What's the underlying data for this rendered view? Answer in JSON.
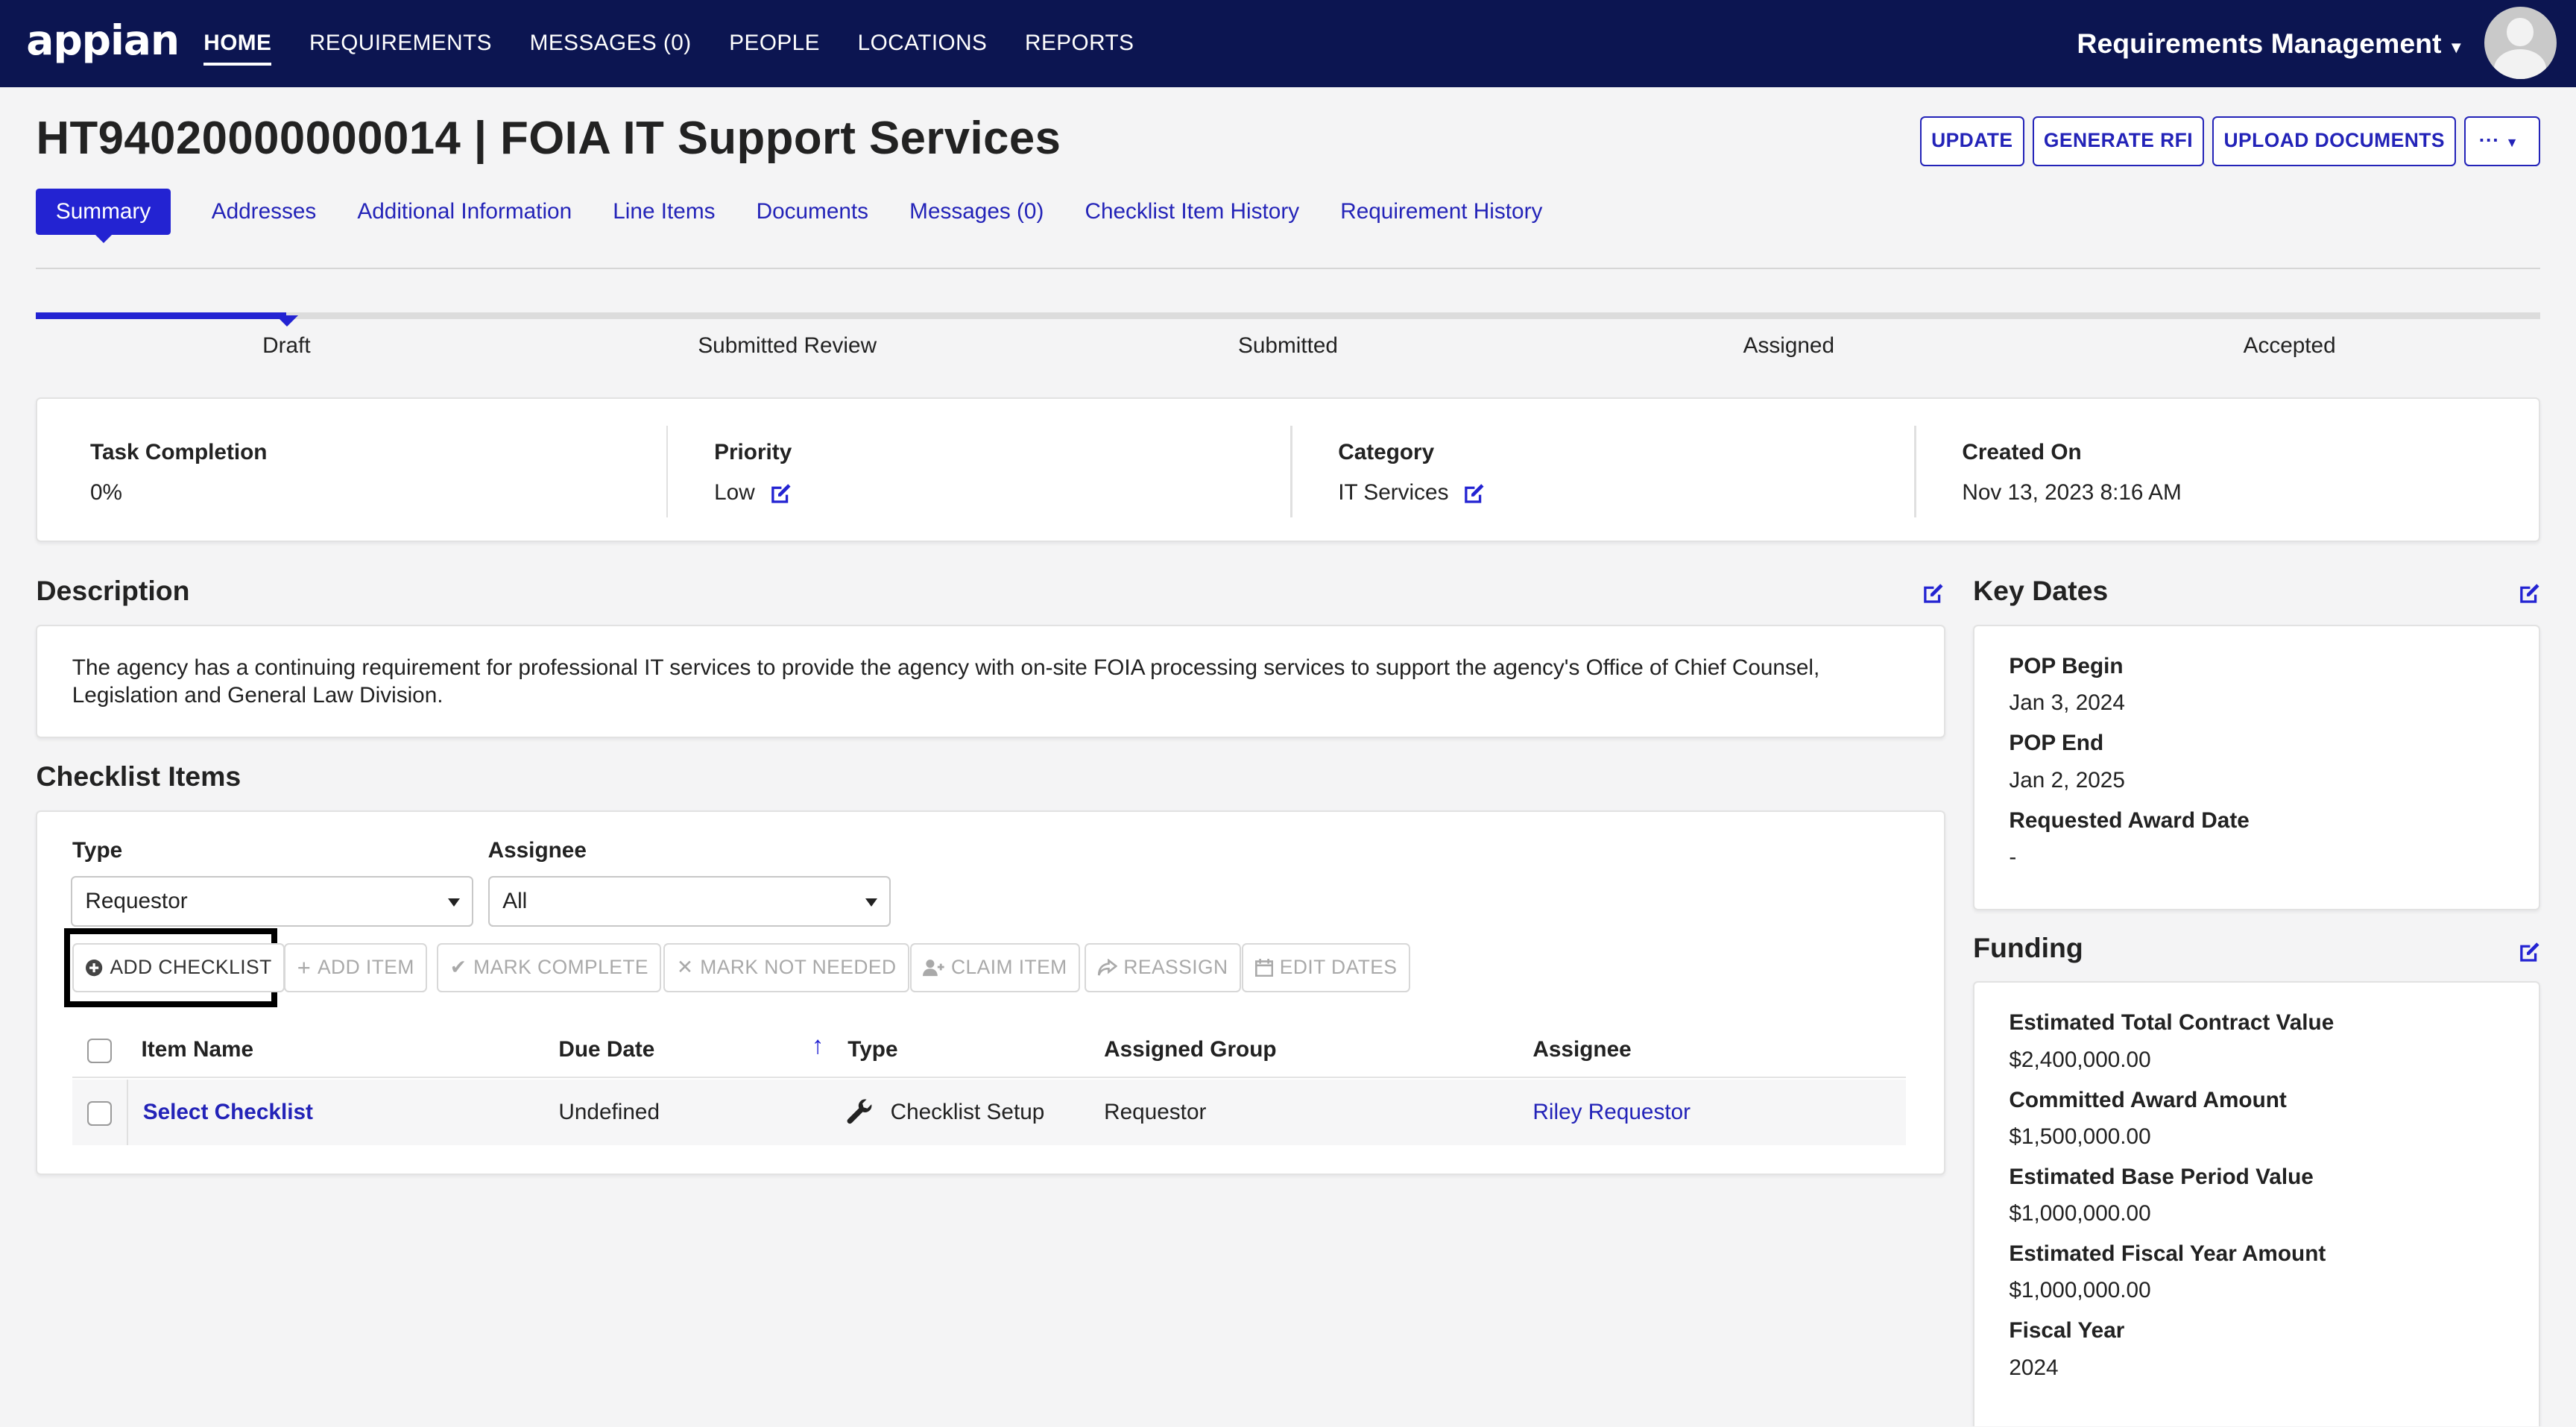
{
  "nav": {
    "logo": "appian",
    "links": [
      "HOME",
      "REQUIREMENTS",
      "MESSAGES (0)",
      "PEOPLE",
      "LOCATIONS",
      "REPORTS"
    ],
    "active": "HOME",
    "app_name": "Requirements Management"
  },
  "header": {
    "title": "HT94020000000014 | FOIA IT Support Services",
    "buttons": {
      "update": "UPDATE",
      "generate_rfi": "GENERATE RFI",
      "upload_documents": "UPLOAD DOCUMENTS",
      "more": "···"
    }
  },
  "tabs": [
    "Summary",
    "Addresses",
    "Additional Information",
    "Line Items",
    "Documents",
    "Messages (0)",
    "Checklist Item History",
    "Requirement History"
  ],
  "progress": {
    "steps": [
      "Draft",
      "Submitted Review",
      "Submitted",
      "Assigned",
      "Accepted"
    ],
    "current_step": "Draft"
  },
  "stats": {
    "task_completion": {
      "label": "Task Completion",
      "value": "0%"
    },
    "priority": {
      "label": "Priority",
      "value": "Low"
    },
    "category": {
      "label": "Category",
      "value": "IT Services"
    },
    "created_on": {
      "label": "Created On",
      "value": "Nov 13, 2023 8:16 AM"
    }
  },
  "description": {
    "heading": "Description",
    "text": "The agency has a continuing requirement for professional IT services to provide the agency with on-site FOIA processing services to support the agency's Office of Chief Counsel, Legislation and General Law Division."
  },
  "checklist": {
    "heading": "Checklist Items",
    "type_label": "Type",
    "type_value": "Requestor",
    "assignee_label": "Assignee",
    "assignee_value": "All",
    "buttons": {
      "add_checklist": "ADD CHECKLIST",
      "add_item": "ADD ITEM",
      "mark_complete": "MARK COMPLETE",
      "mark_not_needed": "MARK NOT NEEDED",
      "claim_item": "CLAIM ITEM",
      "reassign": "REASSIGN",
      "edit_dates": "EDIT DATES"
    },
    "columns": [
      "Item Name",
      "Due Date",
      "Type",
      "Assigned Group",
      "Assignee"
    ],
    "rows": [
      {
        "item_name": "Select Checklist",
        "due_date": "Undefined",
        "type": "Checklist Setup",
        "assigned_group": "Requestor",
        "assignee": "Riley Requestor"
      }
    ]
  },
  "key_dates": {
    "heading": "Key Dates",
    "items": [
      {
        "label": "POP Begin",
        "value": "Jan 3, 2024"
      },
      {
        "label": "POP End",
        "value": "Jan 2, 2025"
      },
      {
        "label": "Requested Award Date",
        "value": "-"
      }
    ]
  },
  "funding": {
    "heading": "Funding",
    "items": [
      {
        "label": "Estimated Total Contract Value",
        "value": "$2,400,000.00"
      },
      {
        "label": "Committed Award Amount",
        "value": "$1,500,000.00"
      },
      {
        "label": "Estimated Base Period Value",
        "value": "$1,000,000.00"
      },
      {
        "label": "Estimated Fiscal Year Amount",
        "value": "$1,000,000.00"
      },
      {
        "label": "Fiscal Year",
        "value": "2024"
      }
    ]
  },
  "colors": {
    "nav_bg": "#0c1551",
    "accent": "#2323d2",
    "link": "#2323b8"
  }
}
